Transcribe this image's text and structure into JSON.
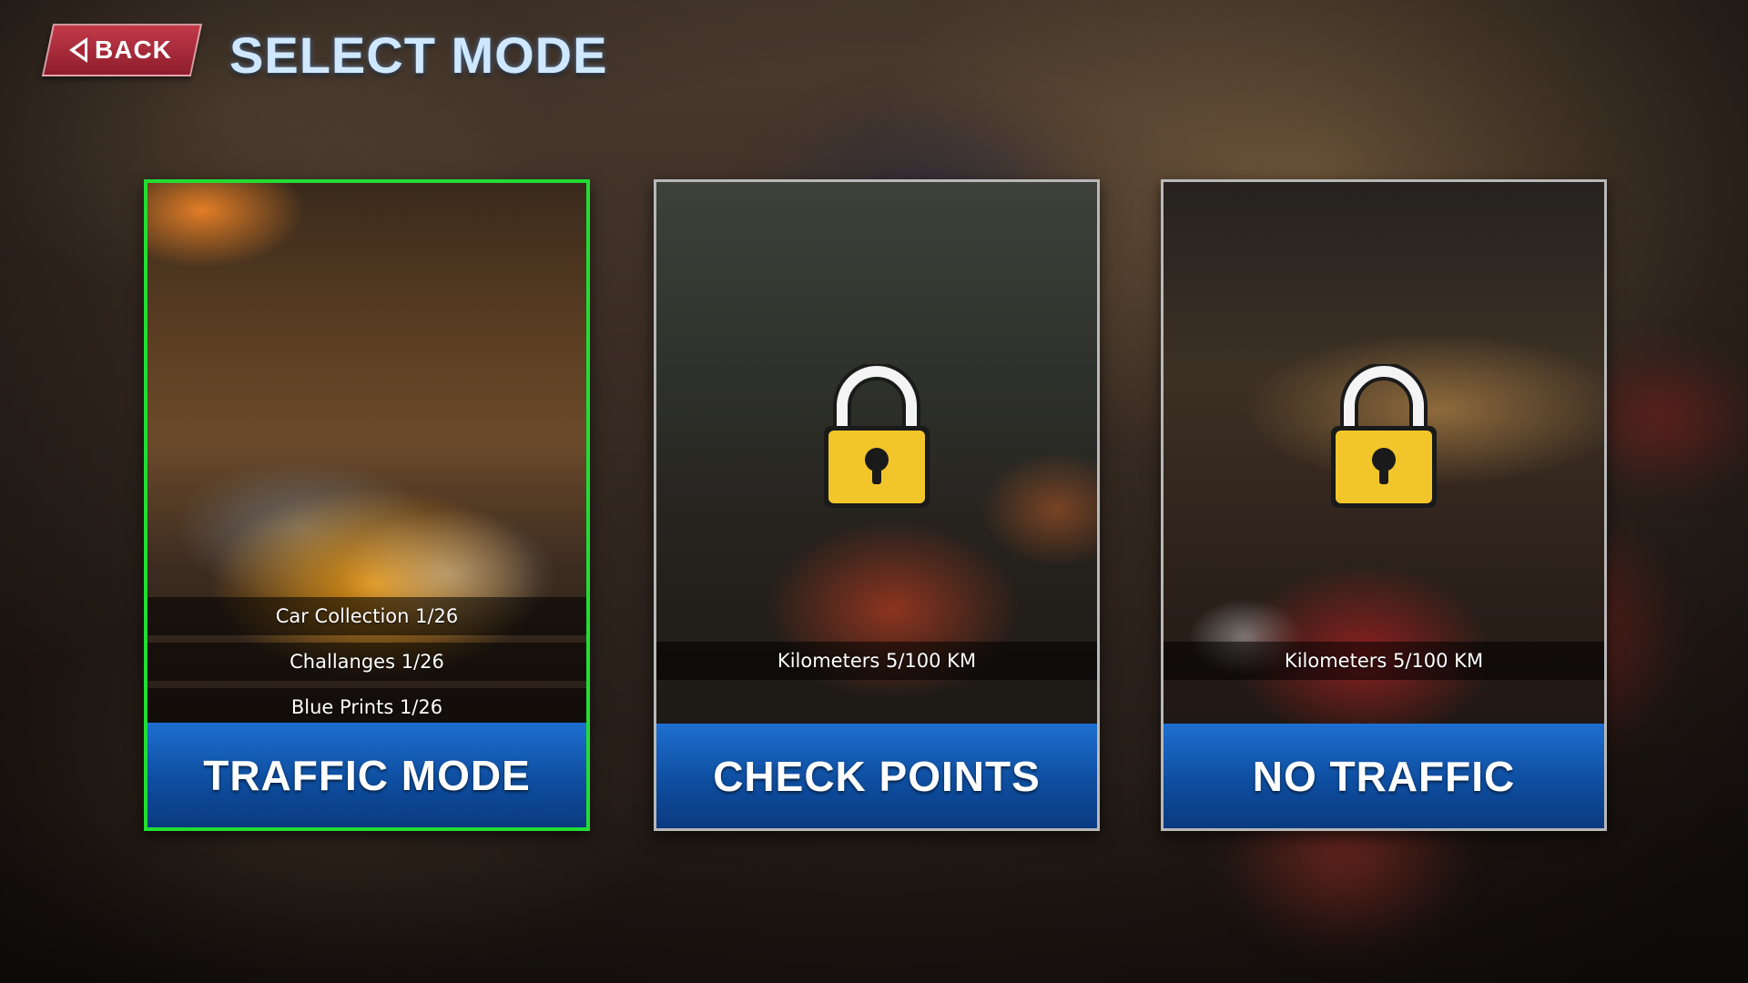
{
  "header": {
    "back_label": "BACK",
    "title": "SELECT MODE"
  },
  "modes": [
    {
      "label": "TRAFFIC MODE",
      "selected": true,
      "locked": false,
      "stats": [
        "Car Collection 1/26",
        "Challanges 1/26",
        "Blue Prints 1/26"
      ]
    },
    {
      "label": "CHECK POINTS",
      "selected": false,
      "locked": true,
      "stats": [
        "Kilometers 5/100 KM"
      ]
    },
    {
      "label": "NO TRAFFIC",
      "selected": false,
      "locked": true,
      "stats": [
        "Kilometers 5/100 KM"
      ]
    }
  ],
  "colors": {
    "selected_border": "#22dd33",
    "button_blue": "#0e4ea0",
    "back_red": "#a82636",
    "lock_yellow": "#f2c62a"
  },
  "icons": {
    "back": "back-arrow-icon",
    "lock": "padlock-icon"
  }
}
